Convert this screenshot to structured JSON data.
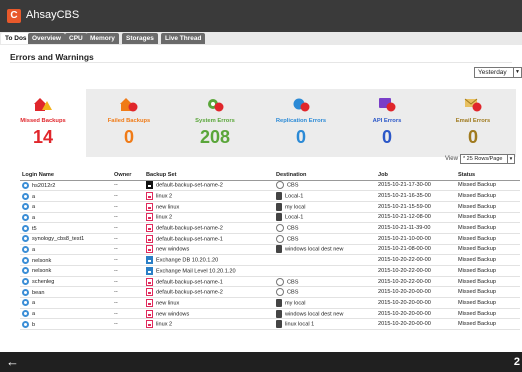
{
  "app": {
    "title": "AhsayCBS",
    "logo_letter": "C"
  },
  "tabs": [
    {
      "label": "To Dos",
      "active": true
    },
    {
      "label": "Overview",
      "active": false
    },
    {
      "label": "CPU",
      "active": false
    },
    {
      "label": "Memory",
      "active": false
    },
    {
      "label": "Storages",
      "active": false
    },
    {
      "label": "Live Thread",
      "active": false
    }
  ],
  "section": {
    "title": "Errors and Warnings"
  },
  "range_select": {
    "value": "Yesterday"
  },
  "cards": [
    {
      "label": "Missed Backups",
      "value": "14",
      "color": "#e0262b",
      "bg": "#ffffff",
      "icon": "missed-backup-icon"
    },
    {
      "label": "Failed Backups",
      "value": "0",
      "color": "#f07b17",
      "bg": "#ececec",
      "icon": "failed-backup-icon"
    },
    {
      "label": "System Errors",
      "value": "208",
      "color": "#5aa63a",
      "bg": "#ececec",
      "icon": "system-error-icon"
    },
    {
      "label": "Replication Errors",
      "value": "0",
      "color": "#2b8ad6",
      "bg": "#ececec",
      "icon": "replication-error-icon"
    },
    {
      "label": "API Errors",
      "value": "0",
      "color": "#2b57c8",
      "bg": "#ececec",
      "icon": "api-error-icon"
    },
    {
      "label": "Email Errors",
      "value": "0",
      "color": "#a07a1e",
      "bg": "#ececec",
      "icon": "email-error-icon"
    }
  ],
  "view": {
    "label": "View",
    "value": "* 25 Rows/Page"
  },
  "table": {
    "columns": [
      "Login Name",
      "Owner",
      "Backup Set",
      "Destination",
      "Job",
      "Status"
    ],
    "rows": [
      {
        "login": "hs2012r2",
        "owner": "--",
        "backup_set": "default-backup-set-name-2",
        "bs_icon": "k",
        "destination": "CBS",
        "dest_icon": "cloud",
        "job": "2015-10-21-17-30-00",
        "status": "Missed Backup"
      },
      {
        "login": "a",
        "owner": "--",
        "backup_set": "linux 2",
        "bs_icon": "r",
        "destination": "Local-1",
        "dest_icon": "drive",
        "job": "2015-10-21-16-35-00",
        "status": "Missed Backup"
      },
      {
        "login": "a",
        "owner": "--",
        "backup_set": "new linux",
        "bs_icon": "r",
        "destination": "my local",
        "dest_icon": "drive",
        "job": "2015-10-21-15-59-00",
        "status": "Missed Backup"
      },
      {
        "login": "a",
        "owner": "--",
        "backup_set": "linux 2",
        "bs_icon": "r",
        "destination": "Local-1",
        "dest_icon": "drive",
        "job": "2015-10-21-12-08-00",
        "status": "Missed Backup"
      },
      {
        "login": "t5",
        "owner": "--",
        "backup_set": "default-backup-set-name-2",
        "bs_icon": "r",
        "destination": "CBS",
        "dest_icon": "cloud",
        "job": "2015-10-21-11-39-00",
        "status": "Missed Backup"
      },
      {
        "login": "synology_cbs8_test1",
        "owner": "--",
        "backup_set": "default-backup-set-name-1",
        "bs_icon": "r",
        "destination": "CBS",
        "dest_icon": "cloud",
        "job": "2015-10-21-10-00-00",
        "status": "Missed Backup"
      },
      {
        "login": "a",
        "owner": "--",
        "backup_set": "new windows",
        "bs_icon": "r",
        "destination": "windows local dest new",
        "dest_icon": "drive",
        "job": "2015-10-21-08-00-00",
        "status": "Missed Backup"
      },
      {
        "login": "nelsonk",
        "owner": "--",
        "backup_set": "Exchange DB 10.20.1.20",
        "bs_icon": "b",
        "destination": "",
        "dest_icon": "",
        "job": "2015-10-20-22-00-00",
        "status": "Missed Backup"
      },
      {
        "login": "nelsonk",
        "owner": "--",
        "backup_set": "Exchange Mail Level 10.20.1.20",
        "bs_icon": "b",
        "destination": "",
        "dest_icon": "",
        "job": "2015-10-20-22-00-00",
        "status": "Missed Backup"
      },
      {
        "login": "schenleg",
        "owner": "--",
        "backup_set": "default-backup-set-name-1",
        "bs_icon": "r",
        "destination": "CBS",
        "dest_icon": "cloud",
        "job": "2015-10-20-22-00-00",
        "status": "Missed Backup"
      },
      {
        "login": "bean",
        "owner": "--",
        "backup_set": "default-backup-set-name-2",
        "bs_icon": "r",
        "destination": "CBS",
        "dest_icon": "cloud",
        "job": "2015-10-20-20-00-00",
        "status": "Missed Backup"
      },
      {
        "login": "a",
        "owner": "--",
        "backup_set": "new linux",
        "bs_icon": "r",
        "destination": "my local",
        "dest_icon": "drive",
        "job": "2015-10-20-20-00-00",
        "status": "Missed Backup"
      },
      {
        "login": "a",
        "owner": "--",
        "backup_set": "new windows",
        "bs_icon": "r",
        "destination": "windows local dest new",
        "dest_icon": "drive",
        "job": "2015-10-20-20-00-00",
        "status": "Missed Backup"
      },
      {
        "login": "b",
        "owner": "--",
        "backup_set": "linux 2",
        "bs_icon": "r",
        "destination": "linux local 1",
        "dest_icon": "drive",
        "job": "2015-10-20-20-00-00",
        "status": "Missed Backup"
      }
    ]
  },
  "bottom": {
    "back_glyph": "←",
    "corner": "2"
  }
}
